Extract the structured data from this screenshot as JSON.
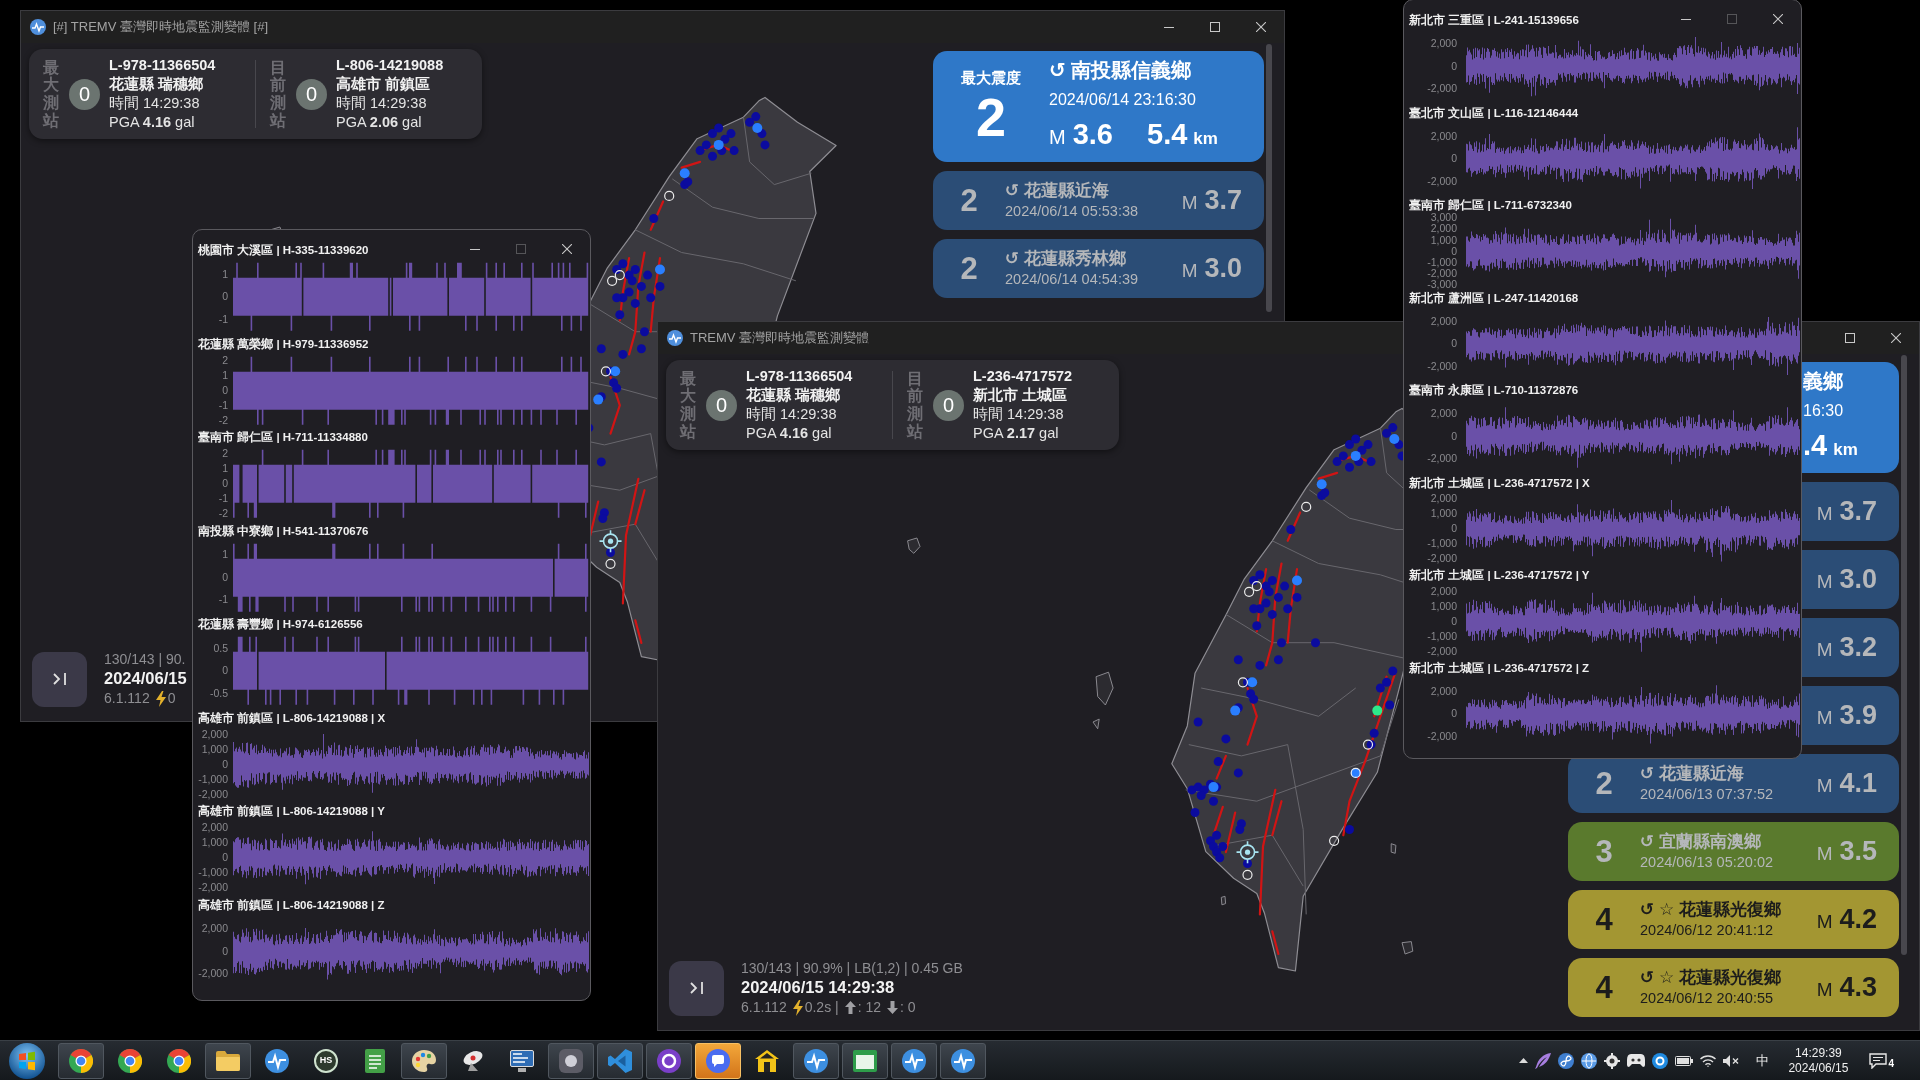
{
  "windows": [
    {
      "kind": "monitor",
      "title": "[#] TREMV 臺灣即時地震監測變體 [#]",
      "title_buttons": [
        {
          "kind": "minimize",
          "disabled": false
        },
        {
          "kind": "maximize",
          "disabled": false
        },
        {
          "kind": "close",
          "disabled": false
        }
      ],
      "stations": [
        {
          "label": "最大測站",
          "intensity": "0",
          "code": "L-978-11366504",
          "place": "花蓮縣 瑞穗鄉",
          "time": "時間 14:29:38",
          "pga": "PGA **4.16** gal"
        },
        {
          "label": "目前測站",
          "intensity": "0",
          "code": "L-806-14219088",
          "place": "高雄市 前鎮區",
          "time": "時間 14:29:38",
          "pga": "PGA **2.06** gal"
        }
      ],
      "quakes": [
        {
          "kind": "latest",
          "color": "#2f78c8",
          "label": "最大震度",
          "intensity": "2",
          "location": "↺ 南投縣信義鄉",
          "time": "2024/06/14 23:16:30",
          "mag_prefix": "M",
          "magnitude": "3.6",
          "depth": "5.4",
          "depth_unit": "km"
        },
        {
          "kind": "entry",
          "color": "#2b4d76",
          "intensity": "2",
          "location": "↺ 花蓮縣近海",
          "time": "2024/06/14 05:53:38",
          "mag_prefix": "M",
          "magnitude": "3.7"
        },
        {
          "kind": "entry",
          "color": "#2b4d76",
          "intensity": "2",
          "location": "↺ 花蓮縣秀林鄉",
          "time": "2024/06/14 04:54:39",
          "mag_prefix": "M",
          "magnitude": "3.0"
        }
      ],
      "status": {
        "stats": "130/143 | 90.",
        "datetime": "2024/06/15",
        "version": "6.1.112",
        "latency": "0"
      }
    },
    {
      "kind": "waveforms",
      "title_buttons": [
        {
          "kind": "minimize",
          "disabled": false
        },
        {
          "kind": "maximize",
          "disabled": true
        },
        {
          "kind": "close",
          "disabled": false
        }
      ],
      "strips": [
        {
          "title": "桃園市 大溪區 | H-335-11339620",
          "kind": "step",
          "ticks": [
            "1",
            "0",
            "-1"
          ]
        },
        {
          "title": "花蓮縣 萬榮鄉 | H-979-11336952",
          "kind": "step",
          "ticks": [
            "2",
            "1",
            "0",
            "-1",
            "-2"
          ]
        },
        {
          "title": "臺南市 歸仁區 | H-711-11334880",
          "kind": "step",
          "ticks": [
            "2",
            "1",
            "0",
            "-1",
            "-2"
          ]
        },
        {
          "title": "南投縣 中寮鄉 | H-541-11370676",
          "kind": "step",
          "ticks": [
            "1",
            "0",
            "-1"
          ]
        },
        {
          "title": "花蓮縣 壽豐鄉 | H-974-6126556",
          "kind": "step",
          "ticks": [
            "0.5",
            "0",
            "-0.5"
          ]
        },
        {
          "title": "高雄市 前鎮區 | L-806-14219088 | X",
          "kind": "noise",
          "ticks": [
            "2,000",
            "1,000",
            "0",
            "-1,000",
            "-2,000"
          ]
        },
        {
          "title": "高雄市 前鎮區 | L-806-14219088 | Y",
          "kind": "noise",
          "ticks": [
            "2,000",
            "1,000",
            "0",
            "-1,000",
            "-2,000"
          ]
        },
        {
          "title": "高雄市 前鎮區 | L-806-14219088 | Z",
          "kind": "noise",
          "ticks": [
            "2,000",
            "0",
            "-2,000"
          ]
        }
      ]
    },
    {
      "kind": "monitor",
      "title": "TREMV 臺灣即時地震監測變體",
      "title_buttons": [
        {
          "kind": "maximize",
          "disabled": false
        },
        {
          "kind": "close",
          "disabled": false
        }
      ],
      "stations": [
        {
          "label": "最大測站",
          "intensity": "0",
          "code": "L-978-11366504",
          "place": "花蓮縣 瑞穗鄉",
          "time": "時間 14:29:38",
          "pga": "PGA **4.16** gal"
        },
        {
          "label": "目前測站",
          "intensity": "0",
          "code": "L-236-4717572",
          "place": "新北市 土城區",
          "time": "時間 14:29:38",
          "pga": "PGA **2.17** gal"
        }
      ],
      "quakes": [
        {
          "kind": "latest",
          "color": "#2f78c8",
          "location": "義鄉",
          "time": "16:30",
          "depth": ".4",
          "depth_unit": "km"
        },
        {
          "kind": "entry",
          "color": "#2b4d76",
          "mag_prefix": "M",
          "magnitude": "3.7"
        },
        {
          "kind": "entry",
          "color": "#2b4d76",
          "mag_prefix": "M",
          "magnitude": "3.0"
        },
        {
          "kind": "entry",
          "color": "#2b4d76",
          "mag_prefix": "M",
          "magnitude": "3.2"
        },
        {
          "kind": "entry",
          "color": "#2b4d76",
          "mag_prefix": "M",
          "magnitude": "3.9"
        },
        {
          "kind": "entry",
          "color": "#2b4d76",
          "intensity": "2",
          "location": "↺ 花蓮縣近海",
          "time": "2024/06/13 07:37:52",
          "mag_prefix": "M",
          "magnitude": "4.1"
        },
        {
          "kind": "entry",
          "color": "#5a7a2d",
          "intensity": "3",
          "location": "↺ 宜蘭縣南澳鄉",
          "time": "2024/06/13 05:20:02",
          "mag_prefix": "M",
          "magnitude": "3.5"
        },
        {
          "kind": "entry",
          "color": "#a39632",
          "intensity": "4",
          "location": "↺ ☆ 花蓮縣光復鄉",
          "time": "2024/06/12 20:41:12",
          "mag_prefix": "M",
          "magnitude": "4.2"
        },
        {
          "kind": "entry",
          "color": "#a39632",
          "intensity": "4",
          "location": "↺ ☆ 花蓮縣光復鄉",
          "time": "2024/06/12 20:40:55",
          "mag_prefix": "M",
          "magnitude": "4.3"
        }
      ],
      "status": {
        "stats": "130/143 | 90.9% | LB(1,2) | 0.45 GB",
        "datetime": "2024/06/15 14:29:38",
        "version": "6.1.112",
        "latency": "0.2s |",
        "uploads": ": 12",
        "downloads": ": 0"
      }
    },
    {
      "kind": "waveforms",
      "title_buttons": [
        {
          "kind": "minimize",
          "disabled": false
        },
        {
          "kind": "maximize",
          "disabled": true
        },
        {
          "kind": "close",
          "disabled": false
        }
      ],
      "strips": [
        {
          "title": "新北市 三重區 | L-241-15139656",
          "kind": "noise",
          "ticks": [
            "2,000",
            "0",
            "-2,000"
          ]
        },
        {
          "title": "臺北市 文山區 | L-116-12146444",
          "kind": "noise",
          "ticks": [
            "2,000",
            "0",
            "-2,000"
          ]
        },
        {
          "title": "臺南市 歸仁區 | L-711-6732340",
          "kind": "noise",
          "ticks": [
            "3,000",
            "2,000",
            "1,000",
            "0",
            "-1,000",
            "-2,000",
            "-3,000"
          ]
        },
        {
          "title": "新北市 蘆洲區 | L-247-11420168",
          "kind": "noise",
          "ticks": [
            "2,000",
            "0",
            "-2,000"
          ]
        },
        {
          "title": "臺南市 永康區 | L-710-11372876",
          "kind": "noise",
          "ticks": [
            "2,000",
            "0",
            "-2,000"
          ]
        },
        {
          "title": "新北市 土城區 | L-236-4717572 | X",
          "kind": "noise",
          "ticks": [
            "2,000",
            "1,000",
            "0",
            "-1,000",
            "-2,000"
          ]
        },
        {
          "title": "新北市 土城區 | L-236-4717572 | Y",
          "kind": "noise",
          "ticks": [
            "2,000",
            "1,000",
            "0",
            "-1,000",
            "-2,000"
          ]
        },
        {
          "title": "新北市 土城區 | L-236-4717572 | Z",
          "kind": "noise",
          "ticks": [
            "2,000",
            "0",
            "-2,000"
          ]
        }
      ]
    }
  ],
  "taskbar": {
    "apps": [
      {
        "kind": "browser",
        "running": true,
        "flashing": false
      },
      {
        "kind": "browser",
        "running": false,
        "flashing": false
      },
      {
        "kind": "browser",
        "running": false,
        "flashing": false
      },
      {
        "kind": "folder",
        "running": true,
        "flashing": false
      },
      {
        "kind": "pulse",
        "running": false,
        "flashing": false
      },
      {
        "kind": "text_badge",
        "label": "HS",
        "running": false,
        "flashing": false
      },
      {
        "kind": "document",
        "running": false,
        "flashing": false
      },
      {
        "kind": "palette",
        "running": true,
        "flashing": false
      },
      {
        "kind": "dish",
        "running": false,
        "flashing": false
      },
      {
        "kind": "monitor",
        "running": false,
        "flashing": false
      },
      {
        "kind": "app",
        "running": true,
        "flashing": false
      },
      {
        "kind": "code",
        "running": true,
        "flashing": false
      },
      {
        "kind": "circle",
        "running": true,
        "flashing": false
      },
      {
        "kind": "chat",
        "running": true,
        "flashing": true
      },
      {
        "kind": "house",
        "running": false,
        "flashing": false
      },
      {
        "kind": "pulse",
        "running": true,
        "flashing": false
      },
      {
        "kind": "window",
        "running": true,
        "flashing": false
      },
      {
        "kind": "pulse",
        "running": true,
        "flashing": false
      },
      {
        "kind": "pulse",
        "running": true,
        "flashing": false
      }
    ],
    "tray": [
      {
        "kind": "chevron"
      },
      {
        "kind": "feather"
      },
      {
        "kind": "fan"
      },
      {
        "kind": "globe"
      },
      {
        "kind": "gear"
      },
      {
        "kind": "gamepad"
      },
      {
        "kind": "circle"
      },
      {
        "kind": "battery"
      },
      {
        "kind": "wifi"
      },
      {
        "kind": "mute"
      }
    ],
    "ime": "中",
    "clock": {
      "time": "14:29:39",
      "date": "2024/06/15"
    },
    "notifications": "4"
  }
}
